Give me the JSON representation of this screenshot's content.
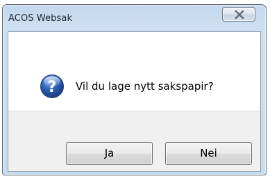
{
  "window": {
    "title": "ACOS Websak"
  },
  "dialog": {
    "message": "Vil du lage nytt sakspapir?",
    "icon": "question-icon",
    "buttons": {
      "yes_label": "Ja",
      "no_label": "Nei"
    }
  },
  "colors": {
    "titlebar": "#c9dbee",
    "icon_blue": "#2a5db0",
    "footer": "#f0f0f0"
  }
}
